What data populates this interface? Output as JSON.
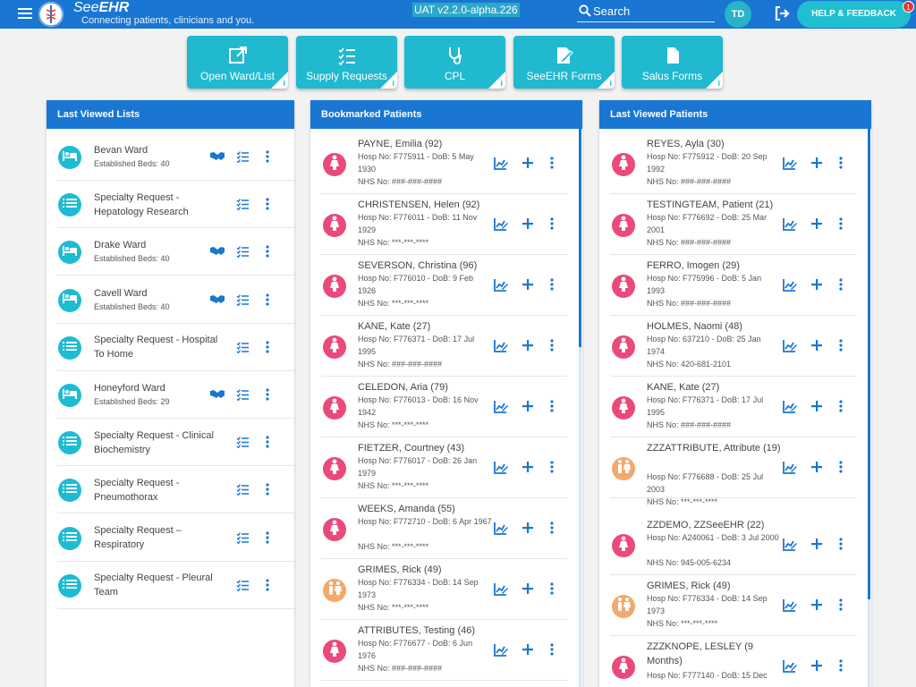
{
  "header": {
    "brand_prefix": "See",
    "brand_suffix": "EHR",
    "tagline": "Connecting patients, clinicians and you.",
    "version": "UAT v2.2.0-alpha.226",
    "search_label": "Search",
    "user_initials": "TD",
    "help_label": "HELP & FEEDBACK",
    "help_badge": "1"
  },
  "colors": {
    "brand_blue": "#1976d2",
    "accent_cyan": "#20b9d0",
    "female": "#ea4a7a",
    "unknown": "#f2a96b",
    "action_blue": "#1976d2"
  },
  "tiles": [
    {
      "label": "Open Ward/List",
      "icon": "open-external-icon",
      "info": "i"
    },
    {
      "label": "Supply Requests",
      "icon": "checklist-icon",
      "info": "i"
    },
    {
      "label": "CPL",
      "icon": "stethoscope-icon",
      "info": "i"
    },
    {
      "label": "SeeEHR Forms",
      "icon": "form-edit-icon",
      "info": "i"
    },
    {
      "label": "Salus Forms",
      "icon": "document-icon",
      "info": "i"
    }
  ],
  "last_viewed_lists": {
    "title": "Last Viewed Lists",
    "items": [
      {
        "title": "Bevan Ward",
        "sub": "Established Beds: 40",
        "type": "ward"
      },
      {
        "title": "Specialty Request - Hepatology Research",
        "sub": "",
        "type": "list"
      },
      {
        "title": "Drake Ward",
        "sub": "Established Beds: 40",
        "type": "ward"
      },
      {
        "title": "Cavell Ward",
        "sub": "Established Beds: 40",
        "type": "ward"
      },
      {
        "title": "Specialty Request - Hospital To Home",
        "sub": "",
        "type": "list"
      },
      {
        "title": "Honeyford Ward",
        "sub": "Established Beds: 29",
        "type": "ward"
      },
      {
        "title": "Specialty Request - Clinical Biochemistry",
        "sub": "",
        "type": "list"
      },
      {
        "title": "Specialty Request - Pneumothorax",
        "sub": "",
        "type": "list"
      },
      {
        "title": "Specialty Request – Respiratory",
        "sub": "",
        "type": "list"
      },
      {
        "title": "Specialty Request - Pleural Team",
        "sub": "",
        "type": "list"
      }
    ]
  },
  "bookmarked_patients": {
    "title": "Bookmarked Patients",
    "items": [
      {
        "name": "PAYNE, Emilia (92)",
        "details": "Hosp No: F775911 - DoB: 5 May 1930",
        "nhs": "NHS No: ###-###-####",
        "gender": "female"
      },
      {
        "name": "CHRISTENSEN, Helen (92)",
        "details": "Hosp No: F776011 - DoB: 11 Nov 1929",
        "nhs": "NHS No: ***-***-****",
        "gender": "female"
      },
      {
        "name": "SEVERSON, Christina (96)",
        "details": "Hosp No: F776010 - DoB: 9 Feb 1926",
        "nhs": "NHS No: ***-***-****",
        "gender": "female"
      },
      {
        "name": "KANE, Kate (27)",
        "details": "Hosp No: F776371 - DoB: 17 Jul 1995",
        "nhs": "NHS No: ###-###-####",
        "gender": "female"
      },
      {
        "name": "CELEDON, Aria (79)",
        "details": "Hosp No: F776013 - DoB: 16 Nov 1942",
        "nhs": "NHS No: ***-***-****",
        "gender": "female"
      },
      {
        "name": "FIETZER, Courtney (43)",
        "details": "Hosp No: F776017 - DoB: 26 Jan 1979",
        "nhs": "NHS No: ***-***-****",
        "gender": "female"
      },
      {
        "name": "WEEKS, Amanda (55)",
        "details": "Hosp No: F772710 - DoB: 6 Apr 1967",
        "nhs": "NHS No: ***-***-****",
        "gender": "female"
      },
      {
        "name": "GRIMES, Rick (49)",
        "details": "Hosp No: F776334 - DoB: 14 Sep 1973",
        "nhs": "NHS No: ***-***-****",
        "gender": "unknown"
      },
      {
        "name": "ATTRIBUTES, Testing (46)",
        "details": "Hosp No: F776677 - DoB: 6 Jun 1976",
        "nhs": "NHS No: ###-###-####",
        "gender": "female"
      }
    ]
  },
  "last_viewed_patients": {
    "title": "Last Viewed Patients",
    "items": [
      {
        "name": "REYES, Ayla (30)",
        "details": "Hosp No: F775912 - DoB: 20 Sep 1992",
        "nhs": "NHS No: ###-###-####",
        "gender": "female"
      },
      {
        "name": "TESTINGTEAM, Patient (21)",
        "details": "Hosp No: F776692 - DoB: 25 Mar 2001",
        "nhs": "NHS No: ###-###-####",
        "gender": "female"
      },
      {
        "name": "FERRO, Imogen (29)",
        "details": "Hosp No: F775996 - DoB: 5 Jan 1993",
        "nhs": "NHS No: ###-###-####",
        "gender": "female"
      },
      {
        "name": "HOLMES, Naomi (48)",
        "details": "Hosp No: 637210 - DoB: 25 Jan 1974",
        "nhs": "NHS No: 420-681-2101",
        "gender": "female"
      },
      {
        "name": "KANE, Kate (27)",
        "details": "Hosp No: F776371 - DoB: 17 Jul 1995",
        "nhs": "NHS No: ###-###-####",
        "gender": "female"
      },
      {
        "name": "ZZZATTRIBUTE, Attribute (19)",
        "details": "Hosp No: F776688 - DoB: 25 Jul 2003",
        "nhs": "NHS No: ***-***-****",
        "gender": "unknown"
      },
      {
        "name": "ZZDEMO, ZZSeeEHR (22)",
        "details": "Hosp No: A240061 - DoB: 3 Jul 2000",
        "nhs": "NHS No: 945-005-6234",
        "gender": "female"
      },
      {
        "name": "GRIMES, Rick (49)",
        "details": "Hosp No: F776334 - DoB: 14 Sep 1973",
        "nhs": "NHS No: ***-***-****",
        "gender": "unknown"
      },
      {
        "name": "ZZZKNOPE, LESLEY (9 Months)",
        "details": "Hosp No: F777140 - DoB: 15 Dec",
        "nhs": "",
        "gender": "female"
      }
    ]
  }
}
